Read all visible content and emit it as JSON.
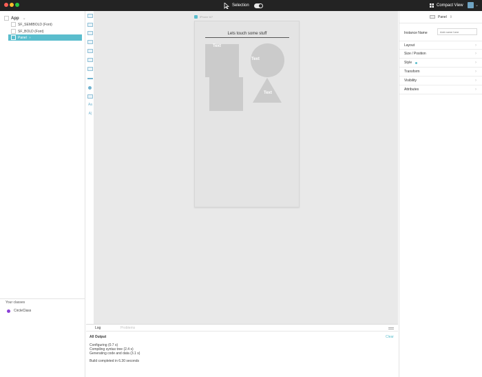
{
  "titlebar": {
    "mode_label": "Selection",
    "compact_label": "Compact View"
  },
  "sidebar": {
    "root": "App",
    "items": [
      {
        "label": "SF_SEMIBOLD (Font)"
      },
      {
        "label": "SF_BOLD (Font)"
      },
      {
        "label": "Panel"
      }
    ],
    "classes_title": "Your classes",
    "classes": [
      {
        "label": "CircleClass",
        "color": "#8a3fd6"
      }
    ]
  },
  "canvas": {
    "device_label": "iPhone 6/7",
    "title": "Lets touch some stuff",
    "shape_labels": [
      "Text",
      "Text",
      "Text"
    ]
  },
  "log": {
    "tabs": [
      "Log",
      "Problems"
    ],
    "heading": "All Output",
    "clear_label": "Clear",
    "lines": [
      "Configuring (0.7 s)",
      "Compiling syntax tree (2.4 s)",
      "Generating code and data (3.1 s)",
      "Build completed in 6.30 seconds"
    ]
  },
  "inspector": {
    "selected": "Panel",
    "instance_label": "Instance Name",
    "instance_placeholder": "Add name here",
    "sections": [
      "Layout",
      "Size / Position",
      "Style",
      "Transform",
      "Visibility",
      "Attributes"
    ]
  },
  "colors": {
    "accent": "#5abdcd",
    "titlebar": "#232323",
    "shape_fill": "#cbcbcb"
  }
}
